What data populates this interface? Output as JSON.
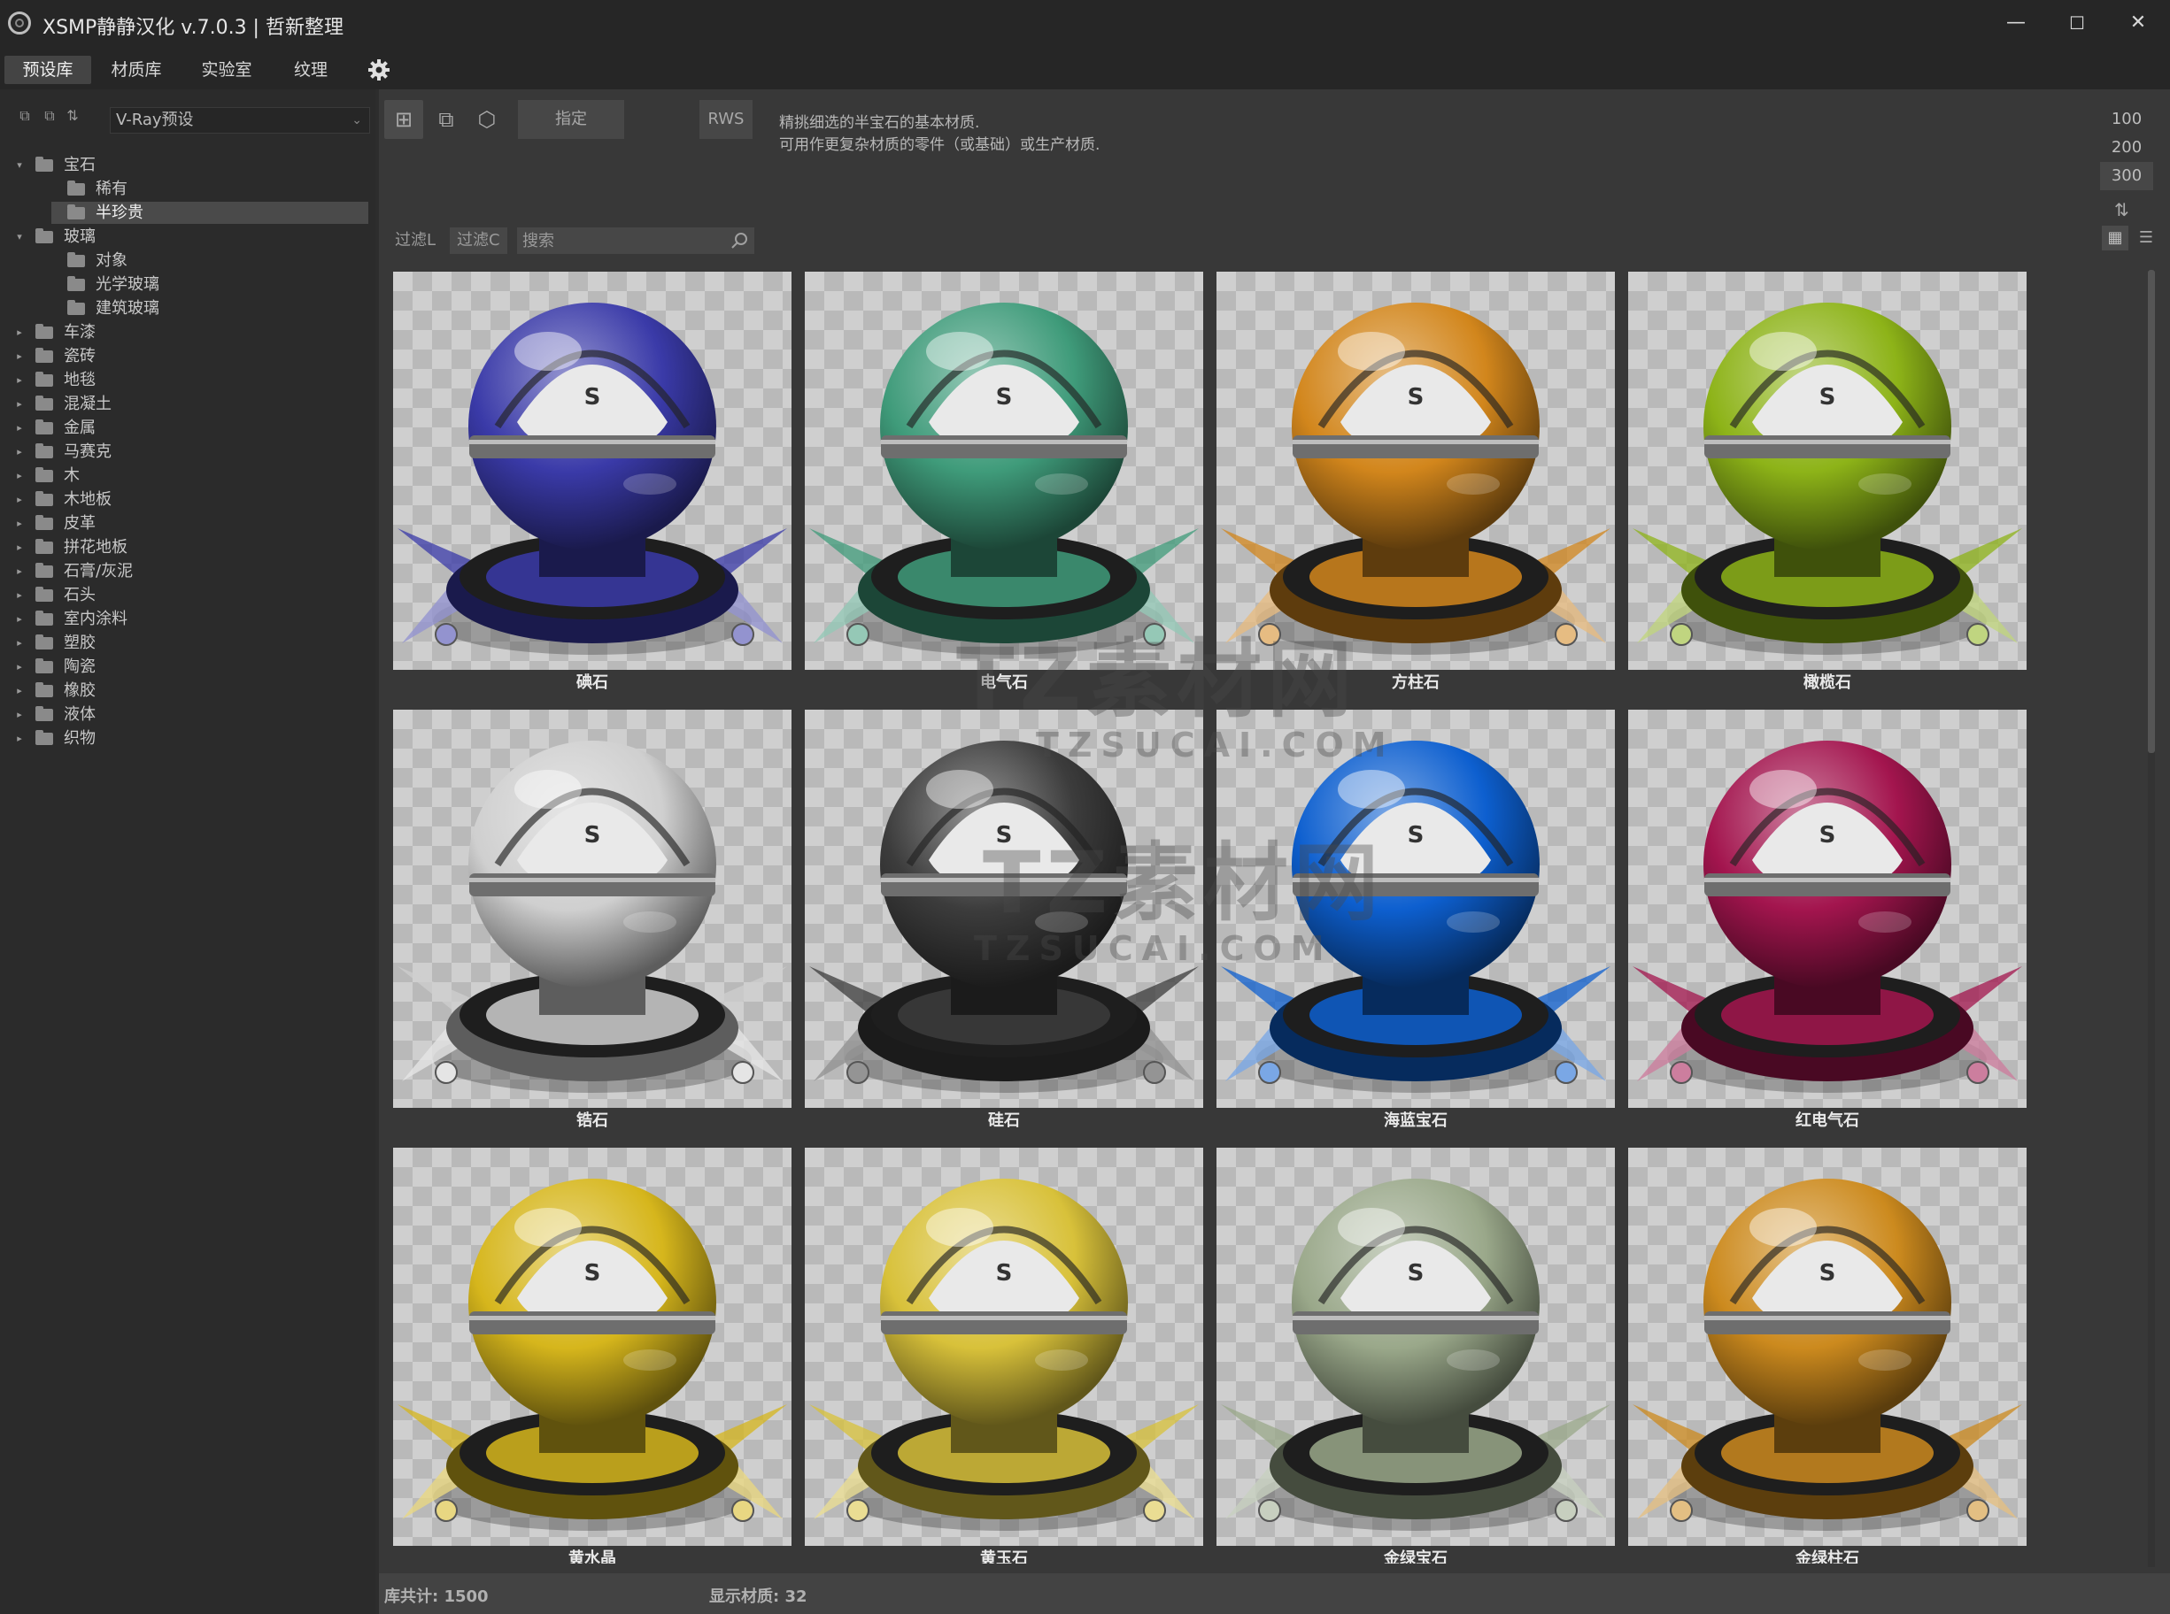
{
  "app": {
    "title": "XSMP静静汉化 v.7.0.3 | 哲新整理"
  },
  "window_controls": {
    "minimize": "—",
    "maximize": "☐",
    "close": "✕"
  },
  "menu": [
    {
      "label": "预设库",
      "active": true
    },
    {
      "label": "材质库",
      "active": false
    },
    {
      "label": "实验室",
      "active": false
    },
    {
      "label": "纹理",
      "active": false
    }
  ],
  "left_panel": {
    "preset_value": "V-Ray预设",
    "tree": [
      {
        "label": "宝石",
        "level": 0,
        "expanded": true
      },
      {
        "label": "稀有",
        "level": 1
      },
      {
        "label": "半珍贵",
        "level": 1,
        "selected": true
      },
      {
        "label": "玻璃",
        "level": 0,
        "expanded": true
      },
      {
        "label": "对象",
        "level": 1
      },
      {
        "label": "光学玻璃",
        "level": 1
      },
      {
        "label": "建筑玻璃",
        "level": 1
      },
      {
        "label": "车漆",
        "level": 0
      },
      {
        "label": "瓷砖",
        "level": 0
      },
      {
        "label": "地毯",
        "level": 0
      },
      {
        "label": "混凝土",
        "level": 0
      },
      {
        "label": "金属",
        "level": 0
      },
      {
        "label": "马赛克",
        "level": 0
      },
      {
        "label": "木",
        "level": 0
      },
      {
        "label": "木地板",
        "level": 0
      },
      {
        "label": "皮革",
        "level": 0
      },
      {
        "label": "拼花地板",
        "level": 0
      },
      {
        "label": "石膏/灰泥",
        "level": 0
      },
      {
        "label": "石头",
        "level": 0
      },
      {
        "label": "室内涂料",
        "level": 0
      },
      {
        "label": "塑胶",
        "level": 0
      },
      {
        "label": "陶瓷",
        "level": 0
      },
      {
        "label": "橡胶",
        "level": 0
      },
      {
        "label": "液体",
        "level": 0
      },
      {
        "label": "织物",
        "level": 0
      }
    ]
  },
  "toolbar": {
    "assign_label": "指定",
    "rws_label": "RWS",
    "description_line1": "精挑细选的半宝石的基本材质.",
    "description_line2": "可用作更复杂材质的零件（或基础）或生产材质.",
    "sizes": [
      "100",
      "200",
      "300"
    ],
    "active_size": "300"
  },
  "filter": {
    "filter_l": "过滤L",
    "filter_c": "过滤C",
    "search_placeholder": "搜索"
  },
  "materials": [
    {
      "name": "碘石",
      "color": "#3a3aa8"
    },
    {
      "name": "电气石",
      "color": "#3f9b7a"
    },
    {
      "name": "方柱石",
      "color": "#d2861c"
    },
    {
      "name": "橄榄石",
      "color": "#8db318"
    },
    {
      "name": "锆石",
      "color": "#cfcfcf"
    },
    {
      "name": "硅石",
      "color": "#3c3c3c"
    },
    {
      "name": "海蓝宝石",
      "color": "#0d5fcf"
    },
    {
      "name": "红电气石",
      "color": "#a3154e"
    },
    {
      "name": "黄水晶",
      "color": "#d6b61c"
    },
    {
      "name": "黄玉石",
      "color": "#d8c13a"
    },
    {
      "name": "金绿宝石",
      "color": "#9aa88a"
    },
    {
      "name": "金绿柱石",
      "color": "#cc8a1e"
    }
  ],
  "statusbar": {
    "library_total": "库共计: 1500",
    "shown_materials": "显示材质: 32"
  },
  "watermark": {
    "line1": "TZ素材网",
    "line2": "TZSUCAI.COM"
  }
}
